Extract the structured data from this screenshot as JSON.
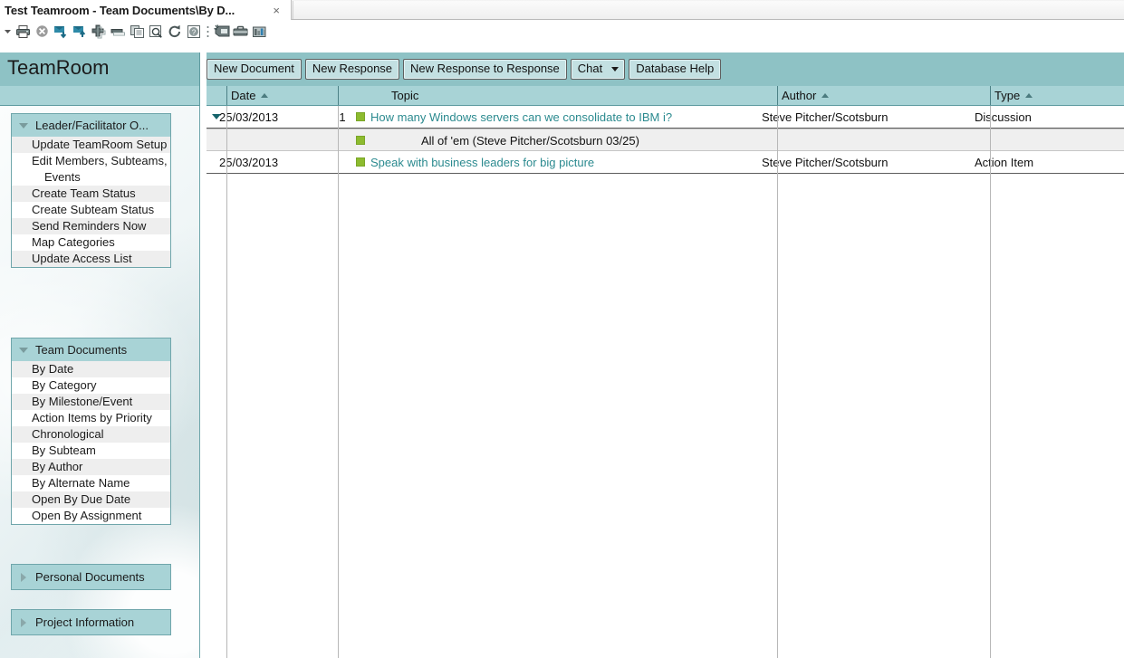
{
  "window": {
    "tab_title": "Test Teamroom - Team Documents\\By D...",
    "close_label": "×"
  },
  "toolbar": {
    "icons": [
      {
        "name": "dropdown-arrow-icon",
        "glyph": "caret"
      },
      {
        "name": "print-icon",
        "glyph": "printer"
      },
      {
        "name": "cancel-icon",
        "glyph": "cancel"
      },
      {
        "name": "move-to-folder-icon",
        "glyph": "flagdown"
      },
      {
        "name": "copy-to-folder-icon",
        "glyph": "flagup"
      },
      {
        "name": "add-icon",
        "glyph": "plus"
      },
      {
        "name": "remove-icon",
        "glyph": "minus"
      },
      {
        "name": "copy-icon",
        "glyph": "copy"
      },
      {
        "name": "search-icon",
        "glyph": "magnify"
      },
      {
        "name": "refresh-icon",
        "glyph": "refresh"
      },
      {
        "name": "help-icon",
        "glyph": "help"
      },
      {
        "name": "separator-icon",
        "glyph": "dots"
      },
      {
        "name": "new-features-icon",
        "glyph": "wand"
      },
      {
        "name": "tools-icon",
        "glyph": "toolbox"
      },
      {
        "name": "charts-icon",
        "glyph": "chart"
      }
    ]
  },
  "header": {
    "title": "TeamRoom",
    "actions": [
      {
        "label": "New Document",
        "type": "button",
        "name": "new-document-button"
      },
      {
        "label": "New Response",
        "type": "button",
        "name": "new-response-button"
      },
      {
        "label": "New Response to Response",
        "type": "button",
        "name": "new-response-to-response-button"
      },
      {
        "label": "Chat",
        "type": "combo",
        "name": "chat-dropdown"
      },
      {
        "label": "Database Help",
        "type": "button",
        "name": "database-help-button"
      }
    ]
  },
  "sidebar": {
    "sections": [
      {
        "name": "leader-facilitator-options",
        "label": "Leader/Facilitator O...",
        "expanded": true,
        "items": [
          "Update TeamRoom Setup",
          "Edit Members, Subteams, Events",
          "Create Team Status",
          "Create Subteam Status",
          "Send Reminders Now",
          "Map Categories",
          "Update Access List"
        ]
      },
      {
        "name": "team-documents",
        "label": "Team Documents",
        "expanded": true,
        "items": [
          "By Date",
          "By Category",
          "By Milestone/Event",
          "Action Items by Priority",
          "Chronological",
          "By Subteam",
          "By Author",
          "By Alternate Name",
          "Open By Due Date",
          "Open By Assignment"
        ]
      },
      {
        "name": "personal-documents",
        "label": "Personal Documents",
        "expanded": false,
        "items": []
      },
      {
        "name": "project-information",
        "label": "Project Information",
        "expanded": false,
        "items": []
      }
    ]
  },
  "view": {
    "columns": [
      {
        "name": "column-date",
        "label": "Date",
        "sorted": true
      },
      {
        "name": "column-topic",
        "label": "Topic",
        "sorted": false
      },
      {
        "name": "column-author",
        "label": "Author",
        "sorted": true
      },
      {
        "name": "column-type",
        "label": "Type",
        "sorted": true
      }
    ],
    "rows": [
      {
        "kind": "main",
        "expanded": true,
        "date": "25/03/2013",
        "response_count": "1",
        "topic": "How many Windows servers can we consolidate to IBM i?",
        "author": "Steve Pitcher/Scotsburn",
        "type": "Discussion"
      },
      {
        "kind": "response",
        "date": "",
        "response_count": "",
        "topic": "All of 'em  (Steve Pitcher/Scotsburn 03/25)",
        "author": "",
        "type": ""
      },
      {
        "kind": "main",
        "expanded": false,
        "date": "25/03/2013",
        "response_count": "",
        "topic": "Speak with business leaders for big picture",
        "author": "Steve Pitcher/Scotsburn",
        "type": "Action Item"
      }
    ]
  },
  "colors": {
    "header_teal": "#8ec2c5",
    "band_light_teal": "#a8d3d6",
    "link_teal": "#2b8a8f",
    "doc_marker_green": "#8dbb2f",
    "button_face": "#c3e0e2"
  }
}
